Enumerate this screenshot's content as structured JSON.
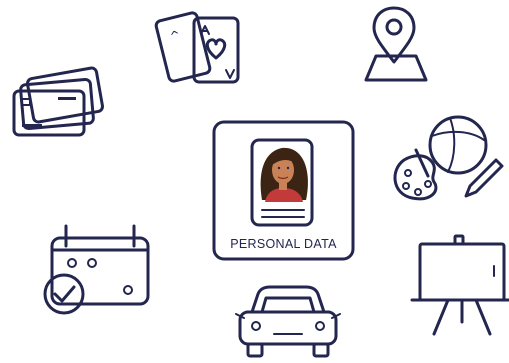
{
  "center_card": {
    "label": "PERSONAL DATA",
    "icon": "id-badge-icon"
  },
  "icons": [
    {
      "name": "credit-cards-icon"
    },
    {
      "name": "playing-cards-icon"
    },
    {
      "name": "location-pin-map-icon"
    },
    {
      "name": "beach-ball-palette-icon"
    },
    {
      "name": "calendar-check-icon"
    },
    {
      "name": "car-icon"
    },
    {
      "name": "presentation-board-icon"
    }
  ],
  "colors": {
    "ink": "#23264e",
    "hair": "#3b2414",
    "skin": "#c98256",
    "shirt": "#c23a3a",
    "background": "#ffffff"
  }
}
